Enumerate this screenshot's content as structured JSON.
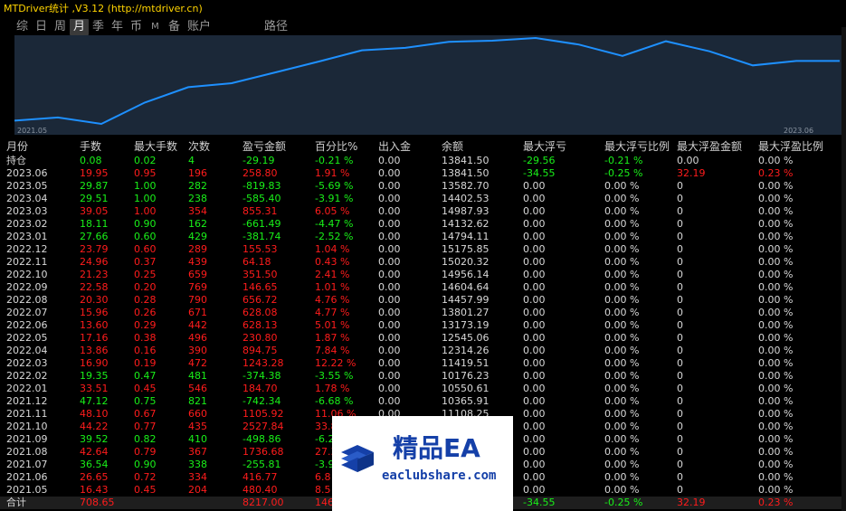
{
  "header": {
    "title": "MTDriver统计 ,V3.12 (http://mtdriver.cn)"
  },
  "tabs": [
    "综",
    "日",
    "周",
    "月",
    "季",
    "年",
    "币",
    "M",
    "备",
    "账户",
    "路径"
  ],
  "active_tab": "月",
  "chart": {
    "start_label": "2021.05",
    "end_label": "2023.06",
    "line_color": "#1e90ff",
    "bg_color": "#1b2838"
  },
  "chart_data": {
    "type": "line",
    "x": [
      "2021.05",
      "2021.06",
      "2021.07",
      "2021.08",
      "2021.09",
      "2021.10",
      "2021.11",
      "2021.12",
      "2022.01",
      "2022.02",
      "2022.03",
      "2022.04",
      "2022.05",
      "2022.06",
      "2022.07",
      "2022.08",
      "2022.09",
      "2022.10",
      "2022.11",
      "2022.12",
      "2023.01",
      "2023.02",
      "2023.03",
      "2023.04",
      "2023.05",
      "2023.06"
    ],
    "y": [
      10365.91,
      10550.61,
      10176.23,
      11419.51,
      12314.26,
      12545.06,
      13173.19,
      13801.27,
      14457.99,
      14604.64,
      14956.14,
      15020.32,
      15175.85,
      14794.11,
      14132.62,
      14987.93,
      14402.53,
      13582.7,
      13841.5,
      13841.5
    ],
    "ylabel": "余额"
  },
  "table": {
    "columns": [
      "月份",
      "手数",
      "最大手数",
      "次数",
      "盈亏金额",
      "百分比%",
      "出入金",
      "余额",
      "最大浮亏",
      "最大浮亏比例",
      "最大浮盈金额",
      "最大浮盈比例"
    ],
    "colors": {
      "red": "#ff1c1c",
      "green": "#19f019",
      "white": "#d8d8d8"
    },
    "rows": [
      {
        "c": [
          "持仓",
          "0.08",
          "0.02",
          "4",
          "-29.19",
          "-0.21 %",
          "0.00",
          "13841.50",
          "-29.56",
          "-0.21 %",
          "0.00",
          "0.00 %"
        ],
        "t": "g"
      },
      {
        "c": [
          "2023.06",
          "19.95",
          "0.95",
          "196",
          "258.80",
          "1.91 %",
          "0.00",
          "13841.50",
          "-34.55",
          "-0.25 %",
          "32.19",
          "0.23 %"
        ],
        "t": "r"
      },
      {
        "c": [
          "2023.05",
          "29.87",
          "1.00",
          "282",
          "-819.83",
          "-5.69 %",
          "0.00",
          "13582.70",
          "0.00",
          "0.00 %",
          "0",
          "0.00 %"
        ],
        "t": "g"
      },
      {
        "c": [
          "2023.04",
          "29.51",
          "1.00",
          "238",
          "-585.40",
          "-3.91 %",
          "0.00",
          "14402.53",
          "0.00",
          "0.00 %",
          "0",
          "0.00 %"
        ],
        "t": "g"
      },
      {
        "c": [
          "2023.03",
          "39.05",
          "1.00",
          "354",
          "855.31",
          "6.05 %",
          "0.00",
          "14987.93",
          "0.00",
          "0.00 %",
          "0",
          "0.00 %"
        ],
        "t": "r"
      },
      {
        "c": [
          "2023.02",
          "18.11",
          "0.90",
          "162",
          "-661.49",
          "-4.47 %",
          "0.00",
          "14132.62",
          "0.00",
          "0.00 %",
          "0",
          "0.00 %"
        ],
        "t": "g"
      },
      {
        "c": [
          "2023.01",
          "27.66",
          "0.60",
          "429",
          "-381.74",
          "-2.52 %",
          "0.00",
          "14794.11",
          "0.00",
          "0.00 %",
          "0",
          "0.00 %"
        ],
        "t": "g"
      },
      {
        "c": [
          "2022.12",
          "23.79",
          "0.60",
          "289",
          "155.53",
          "1.04 %",
          "0.00",
          "15175.85",
          "0.00",
          "0.00 %",
          "0",
          "0.00 %"
        ],
        "t": "r"
      },
      {
        "c": [
          "2022.11",
          "24.96",
          "0.37",
          "439",
          "64.18",
          "0.43 %",
          "0.00",
          "15020.32",
          "0.00",
          "0.00 %",
          "0",
          "0.00 %"
        ],
        "t": "r"
      },
      {
        "c": [
          "2022.10",
          "21.23",
          "0.25",
          "659",
          "351.50",
          "2.41 %",
          "0.00",
          "14956.14",
          "0.00",
          "0.00 %",
          "0",
          "0.00 %"
        ],
        "t": "r"
      },
      {
        "c": [
          "2022.09",
          "22.58",
          "0.20",
          "769",
          "146.65",
          "1.01 %",
          "0.00",
          "14604.64",
          "0.00",
          "0.00 %",
          "0",
          "0.00 %"
        ],
        "t": "r"
      },
      {
        "c": [
          "2022.08",
          "20.30",
          "0.28",
          "790",
          "656.72",
          "4.76 %",
          "0.00",
          "14457.99",
          "0.00",
          "0.00 %",
          "0",
          "0.00 %"
        ],
        "t": "r"
      },
      {
        "c": [
          "2022.07",
          "15.96",
          "0.26",
          "671",
          "628.08",
          "4.77 %",
          "0.00",
          "13801.27",
          "0.00",
          "0.00 %",
          "0",
          "0.00 %"
        ],
        "t": "r"
      },
      {
        "c": [
          "2022.06",
          "13.60",
          "0.29",
          "442",
          "628.13",
          "5.01 %",
          "0.00",
          "13173.19",
          "0.00",
          "0.00 %",
          "0",
          "0.00 %"
        ],
        "t": "r"
      },
      {
        "c": [
          "2022.05",
          "17.16",
          "0.38",
          "496",
          "230.80",
          "1.87 %",
          "0.00",
          "12545.06",
          "0.00",
          "0.00 %",
          "0",
          "0.00 %"
        ],
        "t": "r"
      },
      {
        "c": [
          "2022.04",
          "13.86",
          "0.16",
          "390",
          "894.75",
          "7.84 %",
          "0.00",
          "12314.26",
          "0.00",
          "0.00 %",
          "0",
          "0.00 %"
        ],
        "t": "r"
      },
      {
        "c": [
          "2022.03",
          "16.90",
          "0.19",
          "472",
          "1243.28",
          "12.22 %",
          "0.00",
          "11419.51",
          "0.00",
          "0.00 %",
          "0",
          "0.00 %"
        ],
        "t": "r"
      },
      {
        "c": [
          "2022.02",
          "19.35",
          "0.47",
          "481",
          "-374.38",
          "-3.55 %",
          "0.00",
          "10176.23",
          "0.00",
          "0.00 %",
          "0",
          "0.00 %"
        ],
        "t": "g"
      },
      {
        "c": [
          "2022.01",
          "33.51",
          "0.45",
          "546",
          "184.70",
          "1.78 %",
          "0.00",
          "10550.61",
          "0.00",
          "0.00 %",
          "0",
          "0.00 %"
        ],
        "t": "r"
      },
      {
        "c": [
          "2021.12",
          "47.12",
          "0.75",
          "821",
          "-742.34",
          "-6.68 %",
          "0.00",
          "10365.91",
          "0.00",
          "0.00 %",
          "0",
          "0.00 %"
        ],
        "t": "g"
      },
      {
        "c": [
          "2021.11",
          "48.10",
          "0.67",
          "660",
          "1105.92",
          "11.06 %",
          "0.00",
          "11108.25",
          "0.00",
          "0.00 %",
          "0",
          "0.00 %"
        ],
        "t": "r"
      },
      {
        "c": [
          "2021.10",
          "44.22",
          "0.77",
          "435",
          "2527.84",
          "33.8",
          "",
          "",
          "0.00",
          "0.00 %",
          "0",
          "0.00 %"
        ],
        "t": "r"
      },
      {
        "c": [
          "2021.09",
          "39.52",
          "0.82",
          "410",
          "-498.86",
          "-6.2",
          "",
          "",
          "0.00",
          "0.00 %",
          "0",
          "0.00 %"
        ],
        "t": "g"
      },
      {
        "c": [
          "2021.08",
          "42.64",
          "0.79",
          "367",
          "1736.68",
          "27.3",
          "",
          "",
          "0.00",
          "0.00 %",
          "0",
          "0.00 %"
        ],
        "t": "r"
      },
      {
        "c": [
          "2021.07",
          "36.54",
          "0.90",
          "338",
          "-255.81",
          "-3.9",
          "",
          "",
          "0.00",
          "0.00 %",
          "0",
          "0.00 %"
        ],
        "t": "g"
      },
      {
        "c": [
          "2021.06",
          "26.65",
          "0.72",
          "334",
          "416.77",
          "6.8",
          "",
          "",
          "0.00",
          "0.00 %",
          "0",
          "0.00 %"
        ],
        "t": "r"
      },
      {
        "c": [
          "2021.05",
          "16.43",
          "0.45",
          "204",
          "480.40",
          "8.5",
          "",
          "",
          "0.00",
          "0.00 %",
          "0",
          "0.00 %"
        ],
        "t": "r"
      }
    ],
    "total": {
      "c": [
        "合计",
        "708.65",
        "",
        "",
        "8217.00",
        "146",
        "",
        "",
        "-34.55",
        "-0.25 %",
        "32.19",
        "0.23 %"
      ],
      "colors": [
        "w",
        "r",
        "w",
        "w",
        "r",
        "r",
        "w",
        "w",
        "g",
        "g",
        "r",
        "r"
      ]
    }
  },
  "watermark": {
    "title": "精品EA",
    "subtitle": "eaclubshare.com",
    "color": "#1540a8"
  }
}
